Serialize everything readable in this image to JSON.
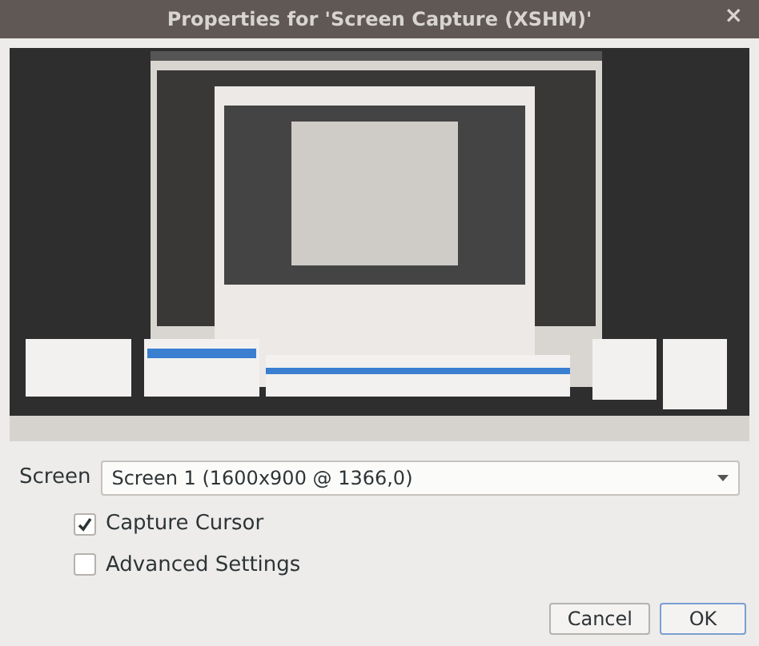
{
  "window": {
    "title": "Properties for 'Screen Capture (XSHM)'",
    "close": "×"
  },
  "screen_field": {
    "label": "Screen",
    "value": "Screen 1 (1600x900 @ 1366,0)"
  },
  "options": [
    {
      "label": "Capture Cursor",
      "checked": true
    },
    {
      "label": "Advanced Settings",
      "checked": false
    }
  ],
  "buttons": [
    {
      "label": "Cancel",
      "kind": "secondary"
    },
    {
      "label": "OK",
      "kind": "primary"
    }
  ]
}
